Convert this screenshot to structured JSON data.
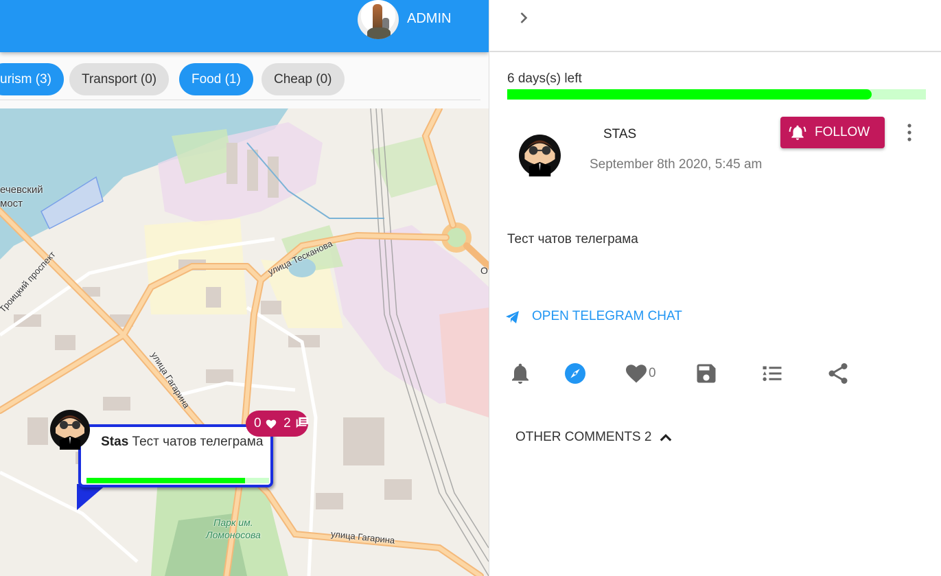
{
  "header": {
    "user_name": "ADMIN",
    "brand_color": "#2196f3"
  },
  "filters": [
    {
      "label": "urism (3)",
      "active": true
    },
    {
      "label": "Transport (0)",
      "active": false
    },
    {
      "label": "Food (1)",
      "active": true
    },
    {
      "label": "Cheap (0)",
      "active": false
    }
  ],
  "map": {
    "labels": {
      "bridge_line1": "ечевский",
      "bridge_line2": "мост",
      "troitsky": "Троицкий проспект",
      "tesnanova": "улица Тесканова",
      "gagarina_1": "улица Гагарина",
      "gagarina_2": "улица Гагарина",
      "park_line1": "Парк им.",
      "park_line2": "Ломоносова",
      "edge": "О"
    },
    "popup": {
      "author": "Stas",
      "text": "Тест чатов телеграма",
      "progress_percent": 87,
      "likes": "0",
      "comments": "2",
      "border_color": "#1a2fe0",
      "badge_color": "#c2185b"
    }
  },
  "panel": {
    "days_left_label": "6 days(s) left",
    "days_progress_percent": 87,
    "author": "STAS",
    "date": "September 8th 2020, 5:45 am",
    "follow_label": "FOLLOW",
    "body": "Тест чатов телеграма",
    "telegram_link": "OPEN TELEGRAM CHAT",
    "actions": {
      "notify": "bell-icon",
      "locate": "compass-icon",
      "like": "heart-icon",
      "like_count": "0",
      "save": "save-icon",
      "list": "list-icon",
      "share": "share-icon"
    },
    "other_comments_label": "OTHER COMMENTS 2",
    "accent_color": "#c2185b",
    "progress_color": "#00ff00"
  }
}
